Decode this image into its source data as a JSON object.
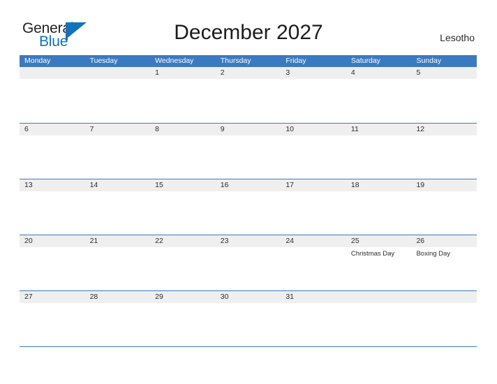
{
  "brand": {
    "name_part1": "General",
    "name_part2": "Blue",
    "flag_color": "#1273b9"
  },
  "header": {
    "title": "December 2027",
    "country": "Lesotho"
  },
  "colors": {
    "header_blue": "#3a7ac0",
    "band_gray": "#efefef",
    "text_dark": "#2b2b2b",
    "brand_blue": "#1273b9"
  },
  "calendar": {
    "month": "December",
    "year": "2027",
    "weekdays": [
      "Monday",
      "Tuesday",
      "Wednesday",
      "Thursday",
      "Friday",
      "Saturday",
      "Sunday"
    ],
    "weeks": [
      {
        "days": [
          {
            "num": "",
            "events": []
          },
          {
            "num": "",
            "events": []
          },
          {
            "num": "1",
            "events": []
          },
          {
            "num": "2",
            "events": []
          },
          {
            "num": "3",
            "events": []
          },
          {
            "num": "4",
            "events": []
          },
          {
            "num": "5",
            "events": []
          }
        ]
      },
      {
        "days": [
          {
            "num": "6",
            "events": []
          },
          {
            "num": "7",
            "events": []
          },
          {
            "num": "8",
            "events": []
          },
          {
            "num": "9",
            "events": []
          },
          {
            "num": "10",
            "events": []
          },
          {
            "num": "11",
            "events": []
          },
          {
            "num": "12",
            "events": []
          }
        ]
      },
      {
        "days": [
          {
            "num": "13",
            "events": []
          },
          {
            "num": "14",
            "events": []
          },
          {
            "num": "15",
            "events": []
          },
          {
            "num": "16",
            "events": []
          },
          {
            "num": "17",
            "events": []
          },
          {
            "num": "18",
            "events": []
          },
          {
            "num": "19",
            "events": []
          }
        ]
      },
      {
        "days": [
          {
            "num": "20",
            "events": []
          },
          {
            "num": "21",
            "events": []
          },
          {
            "num": "22",
            "events": []
          },
          {
            "num": "23",
            "events": []
          },
          {
            "num": "24",
            "events": []
          },
          {
            "num": "25",
            "events": [
              "Christmas Day"
            ]
          },
          {
            "num": "26",
            "events": [
              "Boxing Day"
            ]
          }
        ]
      },
      {
        "days": [
          {
            "num": "27",
            "events": []
          },
          {
            "num": "28",
            "events": []
          },
          {
            "num": "29",
            "events": []
          },
          {
            "num": "30",
            "events": []
          },
          {
            "num": "31",
            "events": []
          },
          {
            "num": "",
            "events": []
          },
          {
            "num": "",
            "events": []
          }
        ]
      }
    ]
  }
}
